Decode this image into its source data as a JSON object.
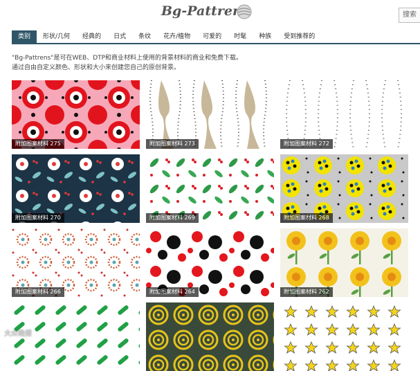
{
  "header": {
    "logo_text": "Bg-Pattrens",
    "search_label": "搜索"
  },
  "nav": {
    "items": [
      "类别",
      "形状/几何",
      "经典的",
      "日式",
      "条纹",
      "花卉/植物",
      "可爱的",
      "时髦",
      "种族",
      "受到推荐的"
    ],
    "active_index": 0
  },
  "intro": {
    "line1": "\"Bg-Pattrens\"是可在WEB、DTP和商业材料上使用的背景材料的商业和免费下载。",
    "line2": "通过自由自定义颜色、形状和大小来创建您自己的原创背景。"
  },
  "tiles": [
    {
      "caption": "附加图案材料 275",
      "pattern": "red-pink-flowers"
    },
    {
      "caption": "附加图案材料 273",
      "pattern": "beige-wave-dots"
    },
    {
      "caption": "附加图案材料 272",
      "pattern": "dotted-waves"
    },
    {
      "caption": "附加图案材料 270",
      "pattern": "navy-white-flowers"
    },
    {
      "caption": "附加图案材料 269",
      "pattern": "green-leaves-berries"
    },
    {
      "caption": "附加图案材料 268",
      "pattern": "yellow-dot-circles"
    },
    {
      "caption": "附加图案材料 266",
      "pattern": "ring-flower-dots"
    },
    {
      "caption": "附加图案材料 264",
      "pattern": "red-black-polka"
    },
    {
      "caption": "附加图案材料 262",
      "pattern": "yellow-sunflowers"
    },
    {
      "caption": "",
      "pattern": "green-dashes"
    },
    {
      "caption": "",
      "pattern": "yellow-spirals"
    },
    {
      "caption": "",
      "pattern": "yellow-stars"
    }
  ],
  "watermark": "大众晚报"
}
